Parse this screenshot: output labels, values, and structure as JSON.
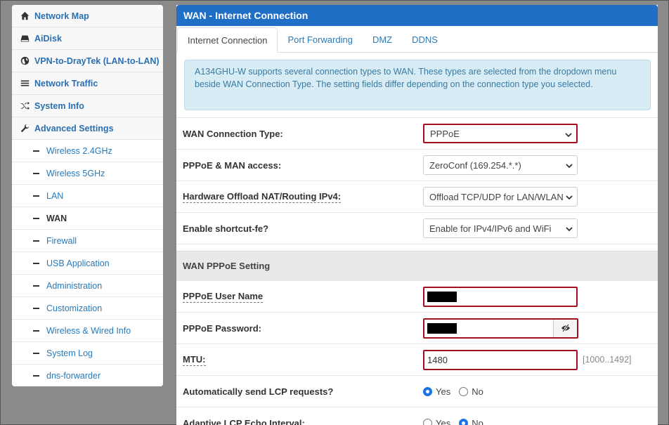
{
  "sidebar": {
    "items": [
      {
        "label": "Network Map",
        "icon": "home-icon"
      },
      {
        "label": "AiDisk",
        "icon": "drive-icon"
      },
      {
        "label": "VPN-to-DrayTek (LAN-to-LAN)",
        "icon": "globe-icon"
      },
      {
        "label": "Network Traffic",
        "icon": "list-icon"
      },
      {
        "label": "System Info",
        "icon": "shuffle-icon"
      },
      {
        "label": "Advanced Settings",
        "icon": "wrench-icon"
      }
    ],
    "sub_items": [
      {
        "label": "Wireless 2.4GHz"
      },
      {
        "label": "Wireless 5GHz"
      },
      {
        "label": "LAN"
      },
      {
        "label": "WAN",
        "active": true
      },
      {
        "label": "Firewall"
      },
      {
        "label": "USB Application"
      },
      {
        "label": "Administration"
      },
      {
        "label": "Customization"
      },
      {
        "label": "Wireless & Wired Info"
      },
      {
        "label": "System Log"
      },
      {
        "label": "dns-forwarder"
      }
    ]
  },
  "main": {
    "title": "WAN - Internet Connection",
    "tabs": [
      {
        "label": "Internet Connection",
        "active": true
      },
      {
        "label": "Port Forwarding"
      },
      {
        "label": "DMZ"
      },
      {
        "label": "DDNS"
      }
    ],
    "info": "A134GHU-W supports several connection types to WAN. These types are selected from the dropdown menu beside WAN Connection Type. The setting fields differ depending on the connection type you selected.",
    "fields": {
      "wan_type": {
        "label": "WAN Connection Type:",
        "value": "PPPoE"
      },
      "man_access": {
        "label": "PPPoE & MAN access:",
        "value": "ZeroConf (169.254.*.*)"
      },
      "hw_offload": {
        "label": "Hardware Offload NAT/Routing IPv4:",
        "value": "Offload TCP/UDP for LAN/WLAN"
      },
      "shortcut": {
        "label": "Enable shortcut-fe?",
        "value": "Enable for IPv4/IPv6 and WiFi"
      }
    },
    "pppoe_section": {
      "title": "WAN PPPoE Setting",
      "username_label": "PPPoE User Name",
      "password_label": "PPPoE Password:",
      "mtu_label": "MTU:",
      "mtu_value": "1480",
      "mtu_hint": "[1000..1492]",
      "lcp_label": "Automatically send LCP requests?",
      "lcp_yes": "Yes",
      "lcp_no": "No",
      "lcp_selected": "Yes",
      "echo_label": "Adaptive LCP Echo Interval:",
      "echo_yes": "Yes",
      "echo_no": "No",
      "echo_selected": "No"
    }
  },
  "colors": {
    "header_blue": "#1f6fc6",
    "link_blue": "#2a7ab8",
    "error_red": "#a3101f",
    "info_bg": "#d8ecf6"
  }
}
